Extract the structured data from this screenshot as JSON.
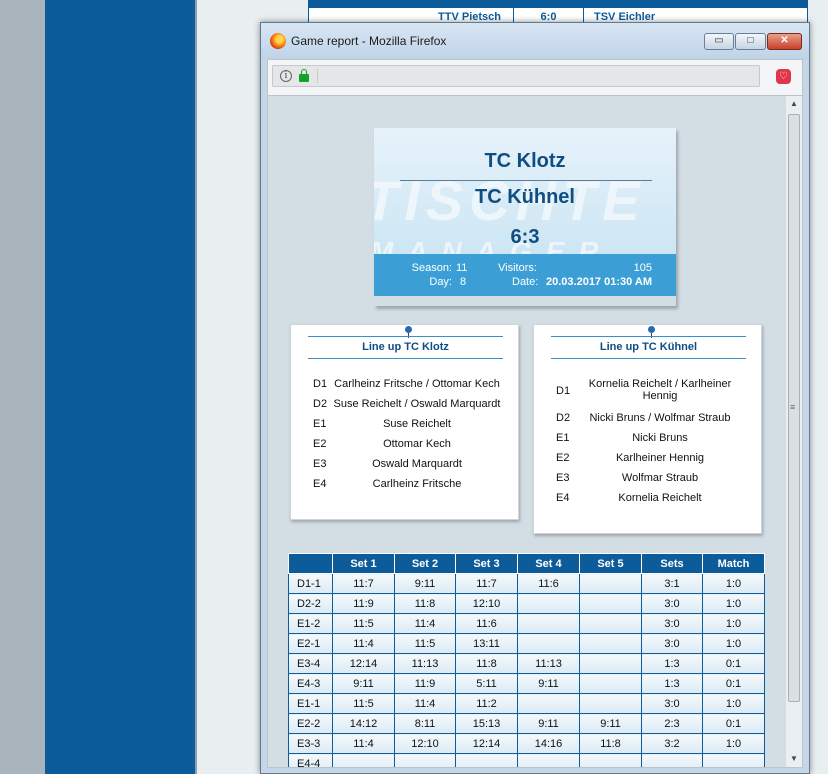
{
  "background": {
    "row": {
      "home": "TTV Pietsch",
      "score": "6:0",
      "guest": "TSV Eichler"
    }
  },
  "window": {
    "title": "Game report - Mozilla Firefox",
    "buttons": {
      "minimize": "▭",
      "maximize": "□",
      "close": "✕"
    }
  },
  "navbar": {
    "info": "i",
    "pocket": "♡"
  },
  "ticket": {
    "home_team": "TC Klotz",
    "away_team": "TC Kühnel",
    "score": "6:3",
    "watermark": "TISCHTE",
    "watermark2": "MANAGER",
    "season_label": "Season:",
    "season_value": "11",
    "day_label": "Day:",
    "day_value": "8",
    "visitors_label": "Visitors:",
    "visitors_value": "105",
    "date_label": "Date:",
    "date_value": "20.03.2017 01:30 AM"
  },
  "lineup_home": {
    "title": "Line up TC Klotz",
    "players": [
      {
        "pos": "D1",
        "names": "Carlheinz Fritsche / Ottomar Kech"
      },
      {
        "pos": "D2",
        "names": "Suse Reichelt / Oswald Marquardt"
      },
      {
        "pos": "E1",
        "names": "Suse Reichelt"
      },
      {
        "pos": "E2",
        "names": "Ottomar Kech"
      },
      {
        "pos": "E3",
        "names": "Oswald Marquardt"
      },
      {
        "pos": "E4",
        "names": "Carlheinz Fritsche"
      }
    ]
  },
  "lineup_away": {
    "title": "Line up TC Kühnel",
    "players": [
      {
        "pos": "D1",
        "names": "Kornelia Reichelt / Karlheiner Hennig"
      },
      {
        "pos": "D2",
        "names": "Nicki Bruns / Wolfmar Straub"
      },
      {
        "pos": "E1",
        "names": "Nicki Bruns"
      },
      {
        "pos": "E2",
        "names": "Karlheiner Hennig"
      },
      {
        "pos": "E3",
        "names": "Wolfmar Straub"
      },
      {
        "pos": "E4",
        "names": "Kornelia Reichelt"
      }
    ]
  },
  "results": {
    "headers": [
      "",
      "Set 1",
      "Set 2",
      "Set 3",
      "Set 4",
      "Set 5",
      "Sets",
      "Match"
    ],
    "rows": [
      [
        "D1-1",
        "11:7",
        "9:11",
        "11:7",
        "11:6",
        "",
        "3:1",
        "1:0"
      ],
      [
        "D2-2",
        "11:9",
        "11:8",
        "12:10",
        "",
        "",
        "3:0",
        "1:0"
      ],
      [
        "E1-2",
        "11:5",
        "11:4",
        "11:6",
        "",
        "",
        "3:0",
        "1:0"
      ],
      [
        "E2-1",
        "11:4",
        "11:5",
        "13:11",
        "",
        "",
        "3:0",
        "1:0"
      ],
      [
        "E3-4",
        "12:14",
        "11:13",
        "11:8",
        "11:13",
        "",
        "1:3",
        "0:1"
      ],
      [
        "E4-3",
        "9:11",
        "11:9",
        "5:11",
        "9:11",
        "",
        "1:3",
        "0:1"
      ],
      [
        "E1-1",
        "11:5",
        "11:4",
        "11:2",
        "",
        "",
        "3:0",
        "1:0"
      ],
      [
        "E2-2",
        "14:12",
        "8:11",
        "15:13",
        "9:11",
        "9:11",
        "2:3",
        "0:1"
      ],
      [
        "E3-3",
        "11:4",
        "12:10",
        "12:14",
        "14:16",
        "11:8",
        "3:2",
        "1:0"
      ],
      [
        "E4-4",
        "",
        "",
        "",
        "",
        "",
        "",
        ""
      ]
    ]
  }
}
